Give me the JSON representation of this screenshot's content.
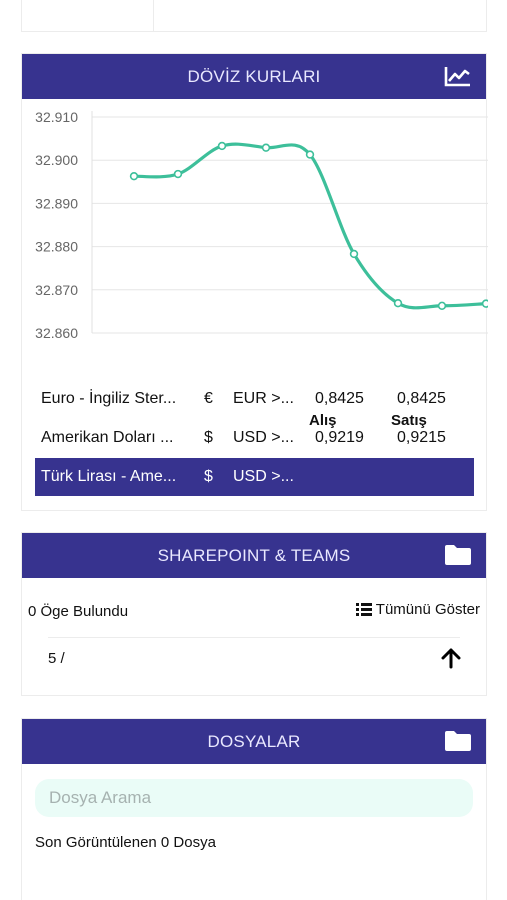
{
  "currency": {
    "title": "DÖVİZ KURLARI",
    "icon": "chart-line-icon",
    "col_buy": "Alış",
    "col_sell": "Satış",
    "rows": [
      {
        "name": "Euro - İngiliz Ster...",
        "symbol": "€",
        "code": "EUR >...",
        "buy": "0,8425",
        "sell": "0,8425",
        "selected": false
      },
      {
        "name": "Amerikan Doları ...",
        "symbol": "$",
        "code": "USD >...",
        "buy": "0,9219",
        "sell": "0,9215",
        "selected": false
      },
      {
        "name": "Türk Lirası - Ame...",
        "symbol": "$",
        "code": "USD >...",
        "buy": "",
        "sell": "",
        "selected": true
      }
    ]
  },
  "chart_data": {
    "type": "line",
    "title": "",
    "xlabel": "",
    "ylabel": "",
    "ylim": [
      32.86,
      32.91
    ],
    "yticks": [
      "32.910",
      "32.900",
      "32.890",
      "32.880",
      "32.870",
      "32.860"
    ],
    "grid": true,
    "line_color": "#3dbf9a",
    "series": [
      {
        "values": [
          32.8963,
          32.8968,
          32.9033,
          32.9029,
          32.9013,
          32.8783,
          32.8669,
          32.8663,
          32.8668
        ]
      }
    ]
  },
  "sharepoint": {
    "title": "SHAREPOINT & TEAMS",
    "icon": "folder-icon",
    "count_text": "0 Öge Bulundu",
    "show_all": "Tümünü Göster",
    "page_text": "5 /"
  },
  "files": {
    "title": "DOSYALAR",
    "icon": "folder-icon",
    "search_placeholder": "Dosya Arama",
    "recent_text": "Son Görüntülenen 0 Dosya"
  },
  "colors": {
    "header_bg": "#37338f",
    "accent_line": "#3dbf9a",
    "search_bg": "#eafcf7"
  }
}
